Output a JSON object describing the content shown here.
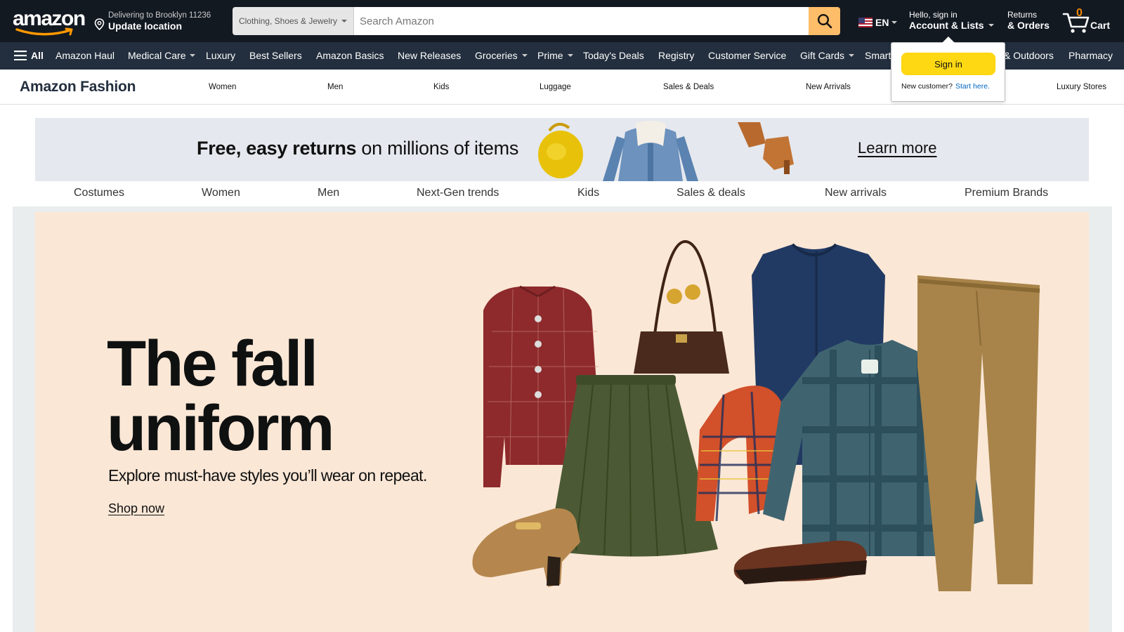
{
  "header": {
    "logo": "amazon",
    "location": {
      "line1": "Delivering to Brooklyn 11236",
      "line2": "Update location"
    },
    "search": {
      "category": "Clothing, Shoes & Jewelry",
      "placeholder": "Search Amazon"
    },
    "language": "EN",
    "account": {
      "line1": "Hello, sign in",
      "line2": "Account & Lists"
    },
    "returns": {
      "line1": "Returns",
      "line2": "& Orders"
    },
    "cart": {
      "count": "0",
      "label": "Cart"
    }
  },
  "subnav": {
    "all": "All",
    "items": [
      "Amazon Haul",
      "Medical Care",
      "Luxury",
      "Best Sellers",
      "Amazon Basics",
      "New Releases",
      "Groceries",
      "Prime",
      "Today's Deals",
      "Registry",
      "Customer Service",
      "Gift Cards",
      "Smart",
      "& Outdoors",
      "Pharmacy"
    ]
  },
  "fashion_bar": {
    "title": "Amazon Fashion",
    "links": [
      "Women",
      "Men",
      "Kids",
      "Luggage",
      "Sales & Deals",
      "New Arrivals",
      "Luxury Stores"
    ]
  },
  "signin_popover": {
    "button": "Sign in",
    "new_customer": "New customer?",
    "start_here": "Start here."
  },
  "banner": {
    "bold": "Free, easy returns",
    "rest": " on millions of items",
    "cta": "Learn more"
  },
  "categories": [
    "Costumes",
    "Women",
    "Men",
    "Next-Gen trends",
    "Kids",
    "Sales & deals",
    "New arrivals",
    "Premium Brands"
  ],
  "hero": {
    "title_line1": "The fall",
    "title_line2": "uniform",
    "subtitle": "Explore must-have styles you’ll wear on repeat.",
    "cta": "Shop now"
  },
  "colors": {
    "nav_dark": "#131921",
    "nav_sub": "#232f3e",
    "search_button": "#febd69",
    "cart_count": "#f08804",
    "signin_button": "#ffd814",
    "hero_bg": "#fbe7d6",
    "banner_bg": "#e5e8ee"
  }
}
